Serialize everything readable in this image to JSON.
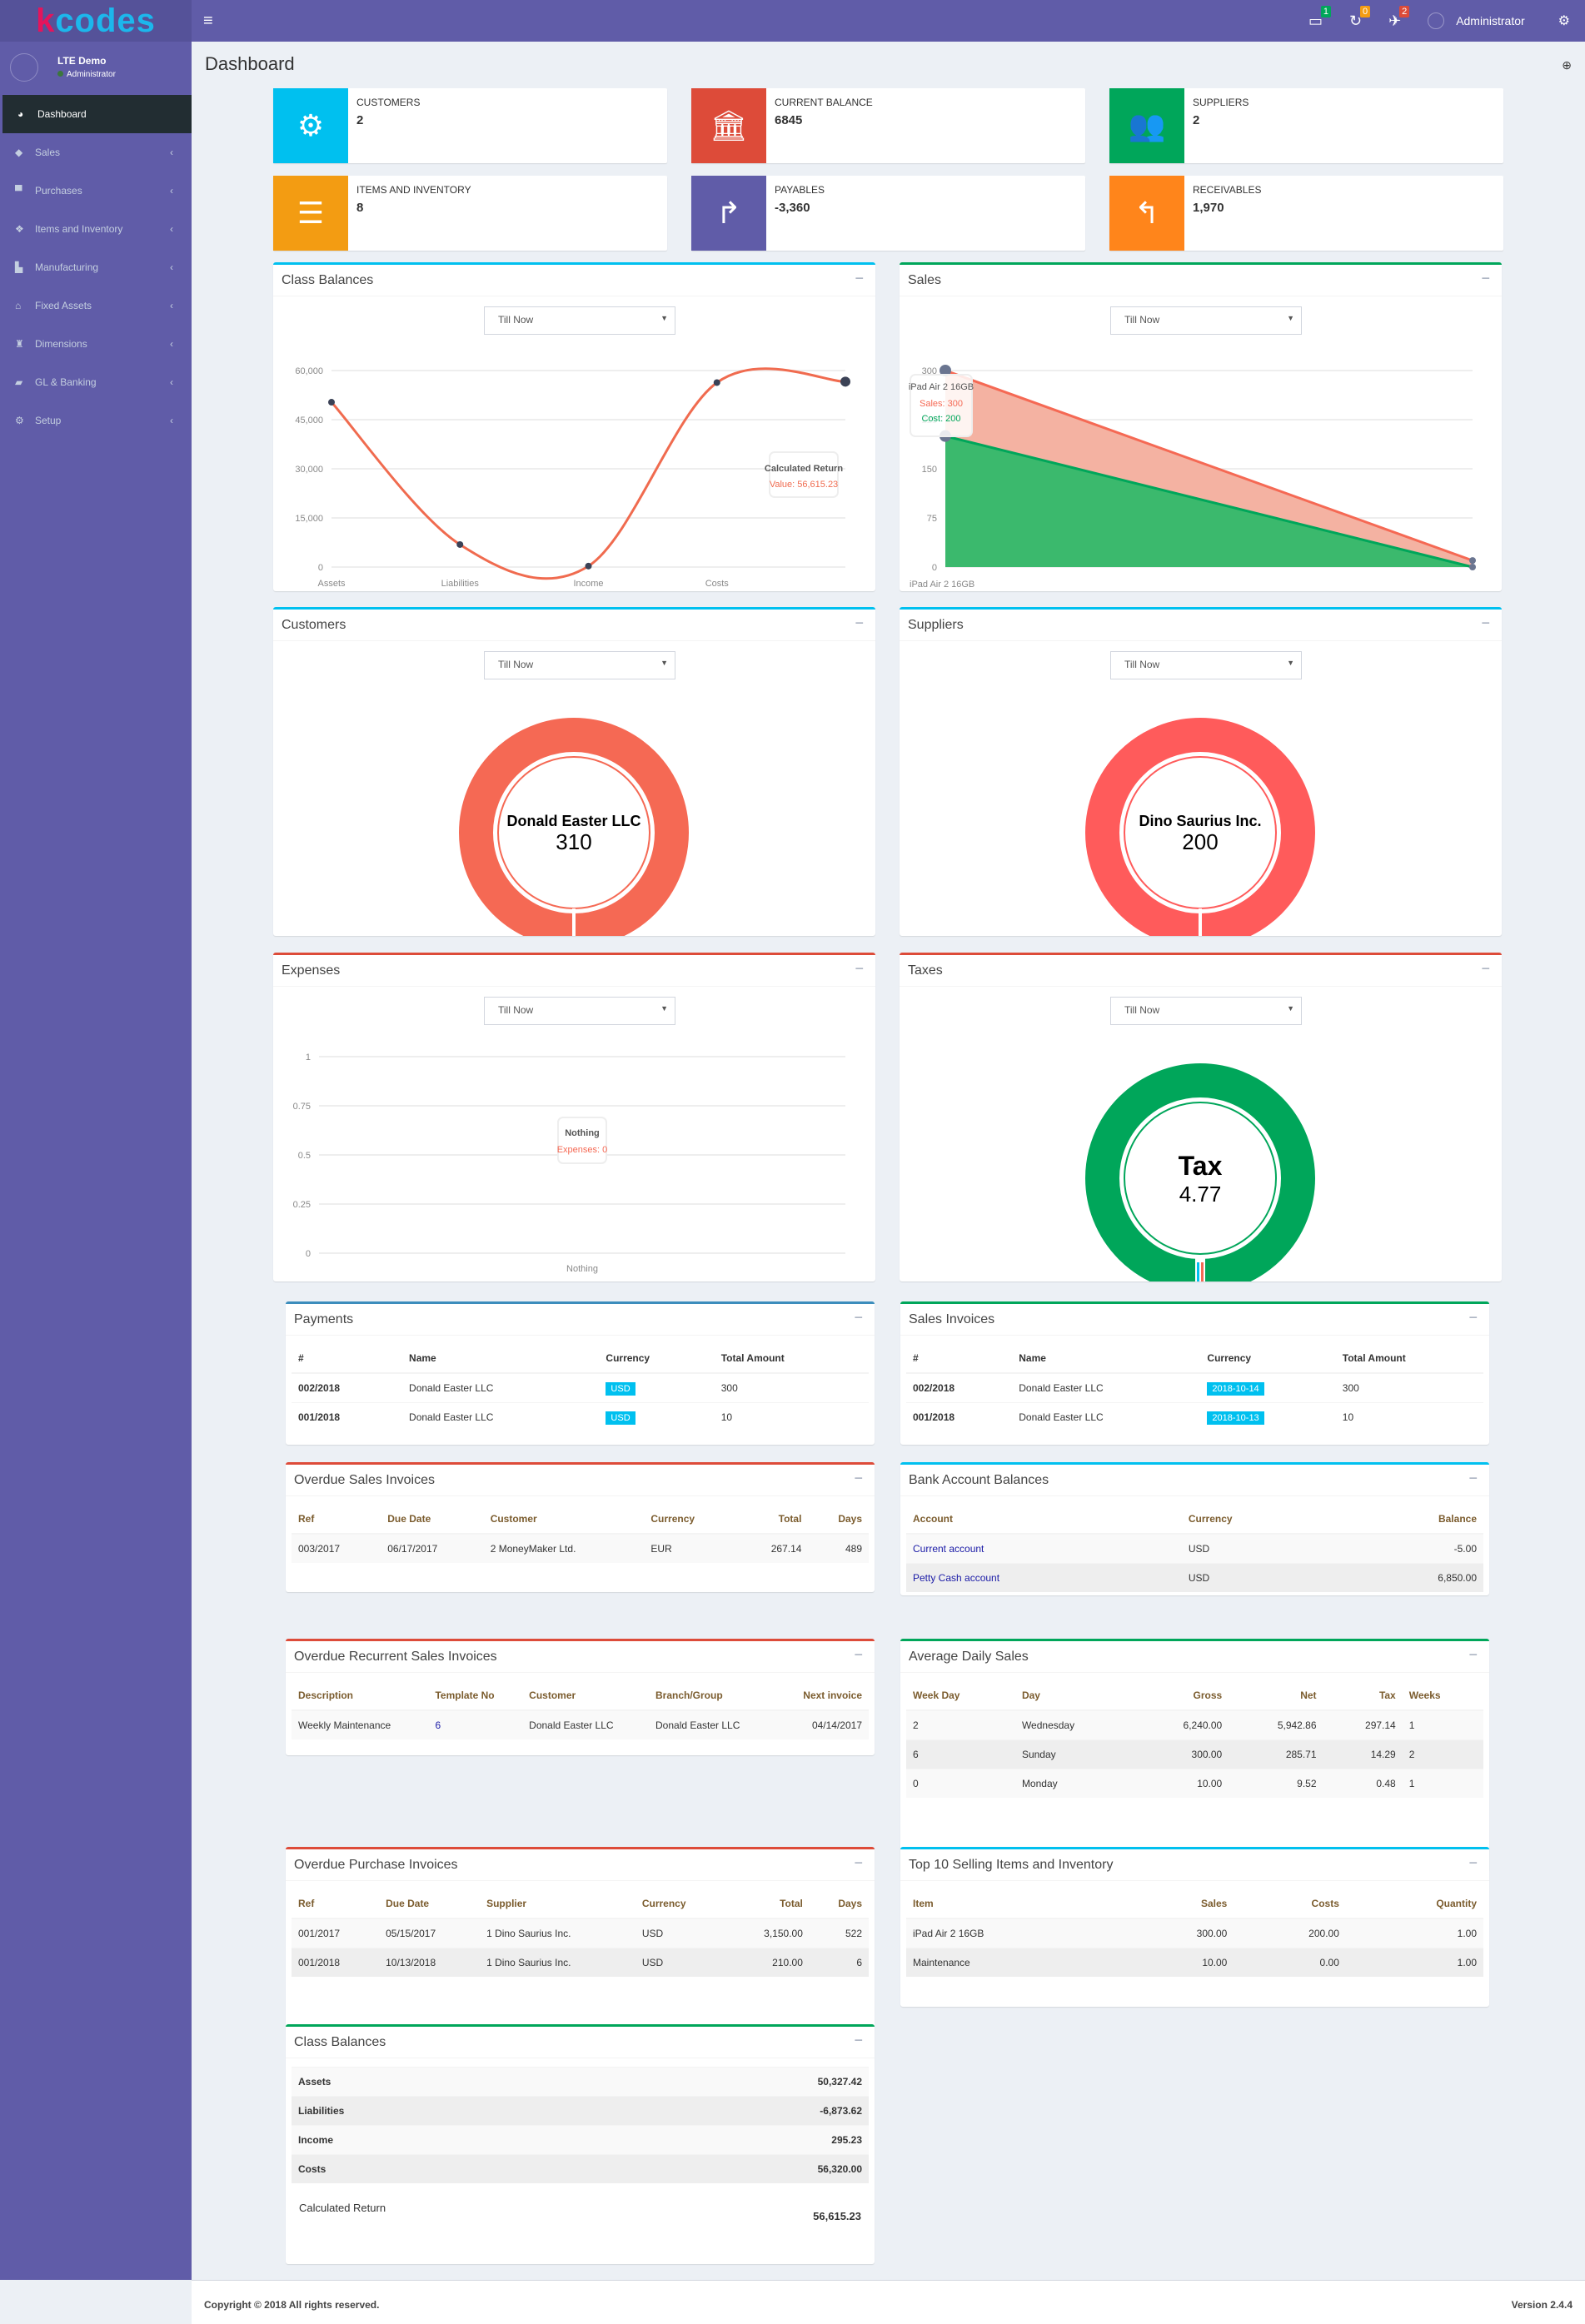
{
  "app": {
    "logo_k": "k",
    "logo_rest": "codes",
    "user": "Administrator",
    "badges": [
      {
        "icon": "credit-card-icon",
        "count": "1",
        "color": "#00a65a"
      },
      {
        "icon": "refresh-icon",
        "count": "0",
        "color": "#f39c12"
      },
      {
        "icon": "plane-icon",
        "count": "2",
        "color": "#dd4b39"
      }
    ]
  },
  "sidebar": {
    "user_name": "LTE Demo",
    "user_role": "Administrator",
    "items": [
      {
        "label": "Dashboard",
        "icon": "dashboard-icon"
      },
      {
        "label": "Sales",
        "icon": "tag-icon"
      },
      {
        "label": "Purchases",
        "icon": "cart-icon"
      },
      {
        "label": "Items and Inventory",
        "icon": "cubes-icon"
      },
      {
        "label": "Manufacturing",
        "icon": "industry-icon"
      },
      {
        "label": "Fixed Assets",
        "icon": "home-icon"
      },
      {
        "label": "Dimensions",
        "icon": "binoculars-icon"
      },
      {
        "label": "GL & Banking",
        "icon": "book-icon"
      },
      {
        "label": "Setup",
        "icon": "cogs-icon"
      }
    ]
  },
  "page": {
    "title": "Dashboard"
  },
  "info_boxes": [
    {
      "label": "Customers",
      "value": "2",
      "color": "#00c0ef",
      "icon": "gear-icon"
    },
    {
      "label": "Current Balance",
      "value": "6845",
      "color": "#dd4b39",
      "icon": "bank-icon"
    },
    {
      "label": "Suppliers",
      "value": "2",
      "color": "#00a65a",
      "icon": "users-icon"
    },
    {
      "label": "Items and Inventory",
      "value": "8",
      "color": "#f39c12",
      "icon": "database-icon"
    },
    {
      "label": "Payables",
      "value": "-3,360",
      "color": "#605ca8",
      "icon": "share-icon"
    },
    {
      "label": "Receivables",
      "value": "1,970",
      "color": "#ff851b",
      "icon": "reply-icon"
    }
  ],
  "filter": "Till Now",
  "panels": {
    "class_balances": "Class Balances",
    "sales": "Sales",
    "customers": "Customers",
    "suppliers": "Suppliers",
    "expenses": "Expenses",
    "taxes": "Taxes"
  },
  "chart_data": [
    {
      "type": "line",
      "title": "Class Balances",
      "categories": [
        "Assets",
        "Liabilities",
        "Income",
        "Costs",
        "Calculated Return"
      ],
      "values": [
        50327.42,
        6873.62,
        295.23,
        56320.0,
        56615.23
      ],
      "ylim": [
        0,
        60000
      ],
      "yticks": [
        "0",
        "15,000",
        "30,000",
        "45,000",
        "60,000"
      ],
      "xlabels": [
        "Assets",
        "Liabilities",
        "Income",
        "Costs"
      ],
      "tooltip": {
        "title": "Calculated Return",
        "text": "Value: 56,615.23"
      }
    },
    {
      "type": "area",
      "title": "Sales",
      "categories": [
        "iPad Air 2 16GB",
        "Maintenance"
      ],
      "series": [
        {
          "name": "Sales",
          "values": [
            300,
            10
          ],
          "color": "#f56954"
        },
        {
          "name": "Cost",
          "values": [
            200,
            0
          ],
          "color": "#00a65a"
        }
      ],
      "ylim": [
        0,
        300
      ],
      "yticks": [
        "0",
        "75",
        "150",
        "225",
        "300"
      ],
      "xlabels": [
        "iPad Air 2 16GB"
      ],
      "tooltip": {
        "title": "iPad Air 2 16GB",
        "lines": [
          "Sales: 300",
          "Cost: 200"
        ]
      }
    },
    {
      "type": "pie",
      "title": "Customers",
      "slices": [
        {
          "label": "Donald Easter LLC",
          "value": 310
        }
      ],
      "center_label": "Donald Easter LLC",
      "center_value": "310",
      "color": "#f56954"
    },
    {
      "type": "pie",
      "title": "Suppliers",
      "slices": [
        {
          "label": "Dino Saurius Inc.",
          "value": 200
        }
      ],
      "center_label": "Dino Saurius Inc.",
      "center_value": "200",
      "color": "#ff5b5b"
    },
    {
      "type": "bar",
      "title": "Expenses",
      "categories": [
        "Nothing"
      ],
      "values": [
        0
      ],
      "ylim": [
        0,
        1
      ],
      "yticks": [
        "0",
        "0.25",
        "0.5",
        "0.75",
        "1"
      ],
      "xlabels": [
        "Nothing"
      ],
      "tooltip": {
        "title": "Nothing",
        "text": "Expenses: 0"
      }
    },
    {
      "type": "pie",
      "title": "Taxes",
      "slices": [
        {
          "label": "Tax",
          "value": 4.77
        }
      ],
      "center_label": "Tax",
      "center_value": "4.77",
      "color": "#00a65a"
    }
  ],
  "payments": {
    "title": "Payments",
    "headers": [
      "#",
      "Name",
      "Currency",
      "Total Amount"
    ],
    "rows": [
      [
        "002/2018",
        "Donald Easter LLC",
        "USD",
        "300"
      ],
      [
        "001/2018",
        "Donald Easter LLC",
        "USD",
        "10"
      ]
    ]
  },
  "sales_invoices": {
    "title": "Sales Invoices",
    "headers": [
      "#",
      "Name",
      "Currency",
      "Total Amount"
    ],
    "rows": [
      [
        "002/2018",
        "Donald Easter LLC",
        "2018-10-14",
        "300"
      ],
      [
        "001/2018",
        "Donald Easter LLC",
        "2018-10-13",
        "10"
      ]
    ]
  },
  "overdue_sales": {
    "title": "Overdue Sales Invoices",
    "headers": [
      "Ref",
      "Due Date",
      "Customer",
      "Currency",
      "Total",
      "Days"
    ],
    "rows": [
      [
        "003/2017",
        "06/17/2017",
        "2 MoneyMaker Ltd.",
        "EUR",
        "267.14",
        "489"
      ]
    ]
  },
  "bank_balances": {
    "title": "Bank Account Balances",
    "headers": [
      "Account",
      "Currency",
      "Balance"
    ],
    "rows": [
      [
        "Current account",
        "USD",
        "-5.00"
      ],
      [
        "Petty Cash account",
        "USD",
        "6,850.00"
      ]
    ]
  },
  "overdue_recurrent": {
    "title": "Overdue Recurrent Sales Invoices",
    "headers": [
      "Description",
      "Template No",
      "Customer",
      "Branch/Group",
      "Next invoice"
    ],
    "rows": [
      [
        "Weekly Maintenance",
        "6",
        "Donald Easter LLC",
        "Donald Easter LLC",
        "04/14/2017"
      ]
    ]
  },
  "avg_daily": {
    "title": "Average Daily Sales",
    "headers": [
      "Week Day",
      "Day",
      "Gross",
      "Net",
      "Tax",
      "Weeks"
    ],
    "rows": [
      [
        "2",
        "Wednesday",
        "6,240.00",
        "5,942.86",
        "297.14",
        "1"
      ],
      [
        "6",
        "Sunday",
        "300.00",
        "285.71",
        "14.29",
        "2"
      ],
      [
        "0",
        "Monday",
        "10.00",
        "9.52",
        "0.48",
        "1"
      ]
    ]
  },
  "overdue_purchase": {
    "title": "Overdue Purchase Invoices",
    "headers": [
      "Ref",
      "Due Date",
      "Supplier",
      "Currency",
      "Total",
      "Days"
    ],
    "rows": [
      [
        "001/2017",
        "05/15/2017",
        "1 Dino Saurius Inc.",
        "USD",
        "3,150.00",
        "522"
      ],
      [
        "001/2018",
        "10/13/2018",
        "1 Dino Saurius Inc.",
        "USD",
        "210.00",
        "6"
      ]
    ]
  },
  "top_items": {
    "title": "Top 10 Selling Items and Inventory",
    "headers": [
      "Item",
      "Sales",
      "Costs",
      "Quantity"
    ],
    "rows": [
      [
        "iPad Air 2 16GB",
        "300.00",
        "200.00",
        "1.00"
      ],
      [
        "Maintenance",
        "10.00",
        "0.00",
        "1.00"
      ]
    ]
  },
  "class_table": {
    "title": "Class Balances",
    "rows": [
      [
        "Assets",
        "50,327.42"
      ],
      [
        "Liabilities",
        "-6,873.62"
      ],
      [
        "Income",
        "295.23"
      ],
      [
        "Costs",
        "56,320.00"
      ]
    ],
    "return_label": "Calculated Return",
    "return_value": "56,615.23"
  },
  "footer": {
    "copyright": "Copyright © 2018 All rights reserved.",
    "version": "Version 2.4.4"
  }
}
